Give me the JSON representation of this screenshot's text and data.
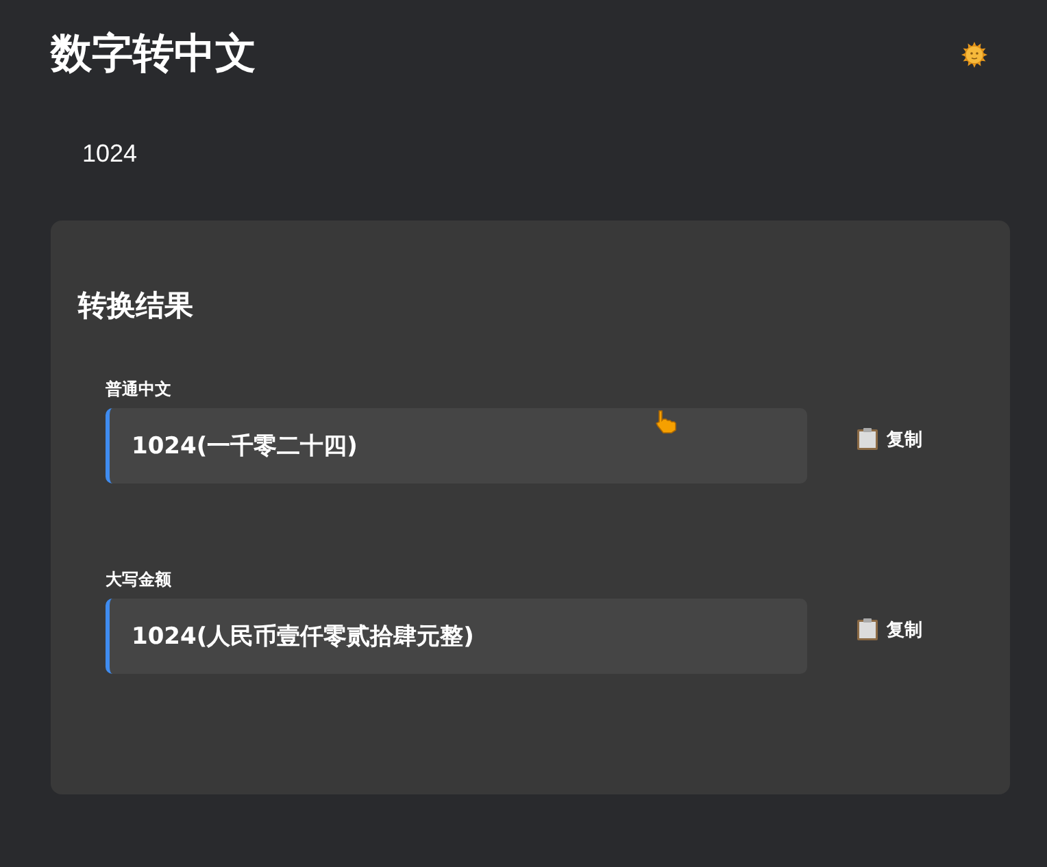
{
  "header": {
    "title": "数字转中文"
  },
  "input": {
    "value": "1024"
  },
  "results": {
    "title": "转换结果",
    "items": [
      {
        "label": "普通中文",
        "value": "1024(一千零二十四)",
        "copy": "复制"
      },
      {
        "label": "大写金额",
        "value": "1024(人民币壹仟零贰拾肆元整)",
        "copy": "复制"
      }
    ]
  }
}
